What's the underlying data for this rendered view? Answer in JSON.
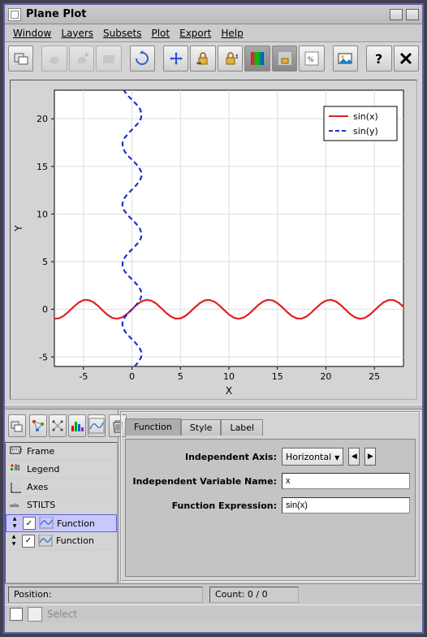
{
  "title": "Plane Plot",
  "menus": [
    "Window",
    "Layers",
    "Subsets",
    "Plot",
    "Export",
    "Help"
  ],
  "chart_data": {
    "type": "line",
    "xlabel": "X",
    "ylabel": "Y",
    "xlim": [
      -8,
      28
    ],
    "ylim": [
      -6,
      23
    ],
    "xticks": [
      -5,
      0,
      5,
      10,
      15,
      20,
      25
    ],
    "yticks": [
      -5,
      0,
      5,
      10,
      15,
      20
    ],
    "legend_position": "top-right",
    "grid": true,
    "series": [
      {
        "name": "sin(x)",
        "color": "#e02020",
        "dash": "solid",
        "expression": "y = sin(x)",
        "x": [
          -8,
          -7.5,
          -7,
          -6.5,
          -6,
          -5.5,
          -5,
          -4.5,
          -4,
          -3.5,
          -3,
          -2.5,
          -2,
          -1.5,
          -1,
          -0.5,
          0,
          0.5,
          1,
          1.5,
          2,
          2.5,
          3,
          3.5,
          4,
          4.5,
          5,
          5.5,
          6,
          6.5,
          7,
          7.5,
          8,
          8.5,
          9,
          9.5,
          10,
          10.5,
          11,
          11.5,
          12,
          12.5,
          13,
          13.5,
          14,
          14.5,
          15,
          15.5,
          16,
          16.5,
          17,
          17.5,
          18,
          18.5,
          19,
          19.5,
          20,
          20.5,
          21,
          21.5,
          22,
          22.5,
          23,
          23.5,
          24,
          24.5,
          25,
          25.5,
          26,
          26.5,
          27,
          27.5,
          28
        ],
        "values": [
          -0.989,
          -0.938,
          -0.657,
          -0.215,
          0.279,
          0.706,
          0.959,
          0.978,
          0.757,
          0.351,
          -0.141,
          -0.599,
          -0.909,
          -0.997,
          -0.841,
          -0.479,
          0,
          0.479,
          0.841,
          0.997,
          0.909,
          0.599,
          0.141,
          -0.351,
          -0.757,
          -0.978,
          -0.959,
          -0.706,
          -0.279,
          0.215,
          0.657,
          0.938,
          0.989,
          0.798,
          0.412,
          -0.075,
          -0.544,
          -0.88,
          -1.0,
          -0.876,
          -0.537,
          -0.066,
          0.42,
          0.804,
          0.991,
          0.935,
          0.65,
          0.207,
          -0.288,
          -0.712,
          -0.961,
          -0.976,
          -0.751,
          -0.343,
          0.15,
          0.606,
          0.913,
          0.997,
          0.837,
          0.472,
          -0.009,
          -0.487,
          -0.846,
          -0.998,
          -0.906,
          -0.592,
          -0.132,
          0.359,
          0.763,
          0.979,
          0.956,
          0.7,
          0.271
        ]
      },
      {
        "name": "sin(y)",
        "color": "#2030d0",
        "dash": "dashed",
        "expression": "x = sin(y)",
        "y": [
          -6,
          -5.5,
          -5,
          -4.5,
          -4,
          -3.5,
          -3,
          -2.5,
          -2,
          -1.5,
          -1,
          -0.5,
          0,
          0.5,
          1,
          1.5,
          2,
          2.5,
          3,
          3.5,
          4,
          4.5,
          5,
          5.5,
          6,
          6.5,
          7,
          7.5,
          8,
          8.5,
          9,
          9.5,
          10,
          10.5,
          11,
          11.5,
          12,
          12.5,
          13,
          13.5,
          14,
          14.5,
          15,
          15.5,
          16,
          16.5,
          17,
          17.5,
          18,
          18.5,
          19,
          19.5,
          20,
          20.5,
          21,
          21.5,
          22,
          22.5,
          23
        ],
        "x_values": [
          0.279,
          0.706,
          0.959,
          0.978,
          0.757,
          0.351,
          -0.141,
          -0.599,
          -0.909,
          -0.997,
          -0.841,
          -0.479,
          0,
          0.479,
          0.841,
          0.997,
          0.909,
          0.599,
          0.141,
          -0.351,
          -0.757,
          -0.978,
          -0.959,
          -0.706,
          -0.279,
          0.215,
          0.657,
          0.938,
          0.989,
          0.798,
          0.412,
          -0.075,
          -0.544,
          -0.88,
          -1.0,
          -0.876,
          -0.537,
          -0.066,
          0.42,
          0.804,
          0.991,
          0.935,
          0.65,
          0.207,
          -0.288,
          -0.712,
          -0.961,
          -0.976,
          -0.751,
          -0.343,
          0.15,
          0.606,
          0.913,
          0.997,
          0.837,
          0.472,
          -0.009,
          -0.487,
          -0.846
        ]
      }
    ]
  },
  "tree": {
    "items": [
      {
        "label": "Frame",
        "icon": "title"
      },
      {
        "label": "Legend",
        "icon": "legend"
      },
      {
        "label": "Axes",
        "icon": "axes"
      },
      {
        "label": "STILTS",
        "icon": "stilts"
      },
      {
        "label": "Function",
        "icon": "func",
        "checked": true,
        "selected": true
      },
      {
        "label": "Function",
        "icon": "func",
        "checked": true
      }
    ]
  },
  "tabs": [
    "Function",
    "Style",
    "Label"
  ],
  "active_tab": 0,
  "form": {
    "axis_label": "Independent Axis:",
    "axis_value": "Horizontal",
    "var_label": "Independent Variable Name:",
    "var_value": "x",
    "expr_label": "Function Expression:",
    "expr_value": "sin(x)"
  },
  "status": {
    "pos_label": "Position:",
    "count_label": "Count: 0 / 0",
    "select_label": "Select"
  }
}
